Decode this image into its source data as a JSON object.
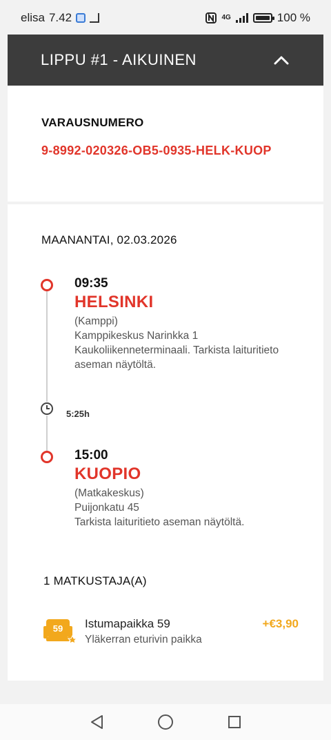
{
  "status_bar": {
    "carrier": "elisa",
    "time": "7.42",
    "network": "4G",
    "battery_percent": "100 %",
    "battery_level": 1.0
  },
  "header": {
    "title": "LIPPU #1 - AIKUINEN",
    "collapse_icon": "chevron-up-icon"
  },
  "booking": {
    "label": "VARAUSNUMERO",
    "number": "9-8992-020326-OB5-0935-HELK-KUOP"
  },
  "trip": {
    "date": "MAANANTAI, 02.03.2026",
    "departure": {
      "time": "09:35",
      "city": "HELSINKI",
      "station": "(Kamppi)",
      "address": "Kamppikeskus Narinkka 1 Kaukoliikenneterminaali. Tarkista laituritieto aseman näytöltä."
    },
    "duration": "5:25h",
    "arrival": {
      "time": "15:00",
      "city": "KUOPIO",
      "station": "(Matkakeskus)",
      "address": "Puijonkatu 45",
      "note": "Tarkista laituritieto aseman näytöltä."
    }
  },
  "passengers": {
    "label": "1 MATKUSTAJA(A)",
    "seat": {
      "number": "59",
      "title": "Istumapaikka 59",
      "subtitle": "Yläkerran eturivin paikka",
      "price": "+€3,90"
    }
  },
  "colors": {
    "accent_red": "#e1352a",
    "header_bg": "#3c3c3c",
    "price_orange": "#f2a81d"
  }
}
